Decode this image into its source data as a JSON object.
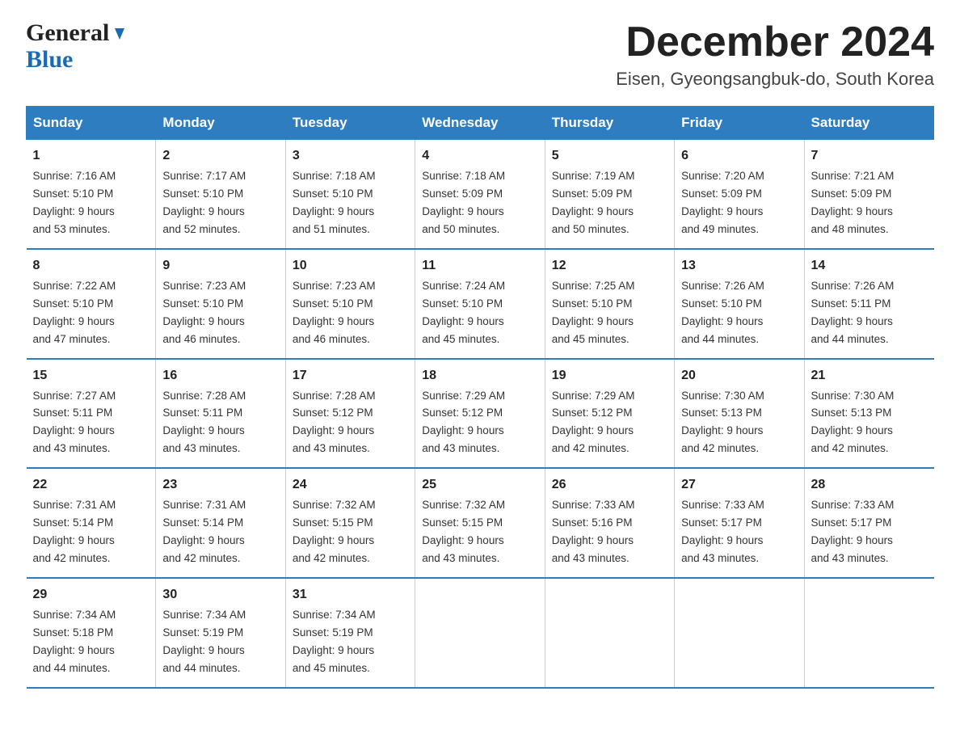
{
  "logo": {
    "general": "General",
    "blue": "Blue",
    "arrow": "▲"
  },
  "title": {
    "month": "December 2024",
    "location": "Eisen, Gyeongsangbuk-do, South Korea"
  },
  "header_days": [
    "Sunday",
    "Monday",
    "Tuesday",
    "Wednesday",
    "Thursday",
    "Friday",
    "Saturday"
  ],
  "weeks": [
    [
      {
        "day": "1",
        "sunrise": "7:16 AM",
        "sunset": "5:10 PM",
        "daylight": "9 hours and 53 minutes."
      },
      {
        "day": "2",
        "sunrise": "7:17 AM",
        "sunset": "5:10 PM",
        "daylight": "9 hours and 52 minutes."
      },
      {
        "day": "3",
        "sunrise": "7:18 AM",
        "sunset": "5:10 PM",
        "daylight": "9 hours and 51 minutes."
      },
      {
        "day": "4",
        "sunrise": "7:18 AM",
        "sunset": "5:09 PM",
        "daylight": "9 hours and 50 minutes."
      },
      {
        "day": "5",
        "sunrise": "7:19 AM",
        "sunset": "5:09 PM",
        "daylight": "9 hours and 50 minutes."
      },
      {
        "day": "6",
        "sunrise": "7:20 AM",
        "sunset": "5:09 PM",
        "daylight": "9 hours and 49 minutes."
      },
      {
        "day": "7",
        "sunrise": "7:21 AM",
        "sunset": "5:09 PM",
        "daylight": "9 hours and 48 minutes."
      }
    ],
    [
      {
        "day": "8",
        "sunrise": "7:22 AM",
        "sunset": "5:10 PM",
        "daylight": "9 hours and 47 minutes."
      },
      {
        "day": "9",
        "sunrise": "7:23 AM",
        "sunset": "5:10 PM",
        "daylight": "9 hours and 46 minutes."
      },
      {
        "day": "10",
        "sunrise": "7:23 AM",
        "sunset": "5:10 PM",
        "daylight": "9 hours and 46 minutes."
      },
      {
        "day": "11",
        "sunrise": "7:24 AM",
        "sunset": "5:10 PM",
        "daylight": "9 hours and 45 minutes."
      },
      {
        "day": "12",
        "sunrise": "7:25 AM",
        "sunset": "5:10 PM",
        "daylight": "9 hours and 45 minutes."
      },
      {
        "day": "13",
        "sunrise": "7:26 AM",
        "sunset": "5:10 PM",
        "daylight": "9 hours and 44 minutes."
      },
      {
        "day": "14",
        "sunrise": "7:26 AM",
        "sunset": "5:11 PM",
        "daylight": "9 hours and 44 minutes."
      }
    ],
    [
      {
        "day": "15",
        "sunrise": "7:27 AM",
        "sunset": "5:11 PM",
        "daylight": "9 hours and 43 minutes."
      },
      {
        "day": "16",
        "sunrise": "7:28 AM",
        "sunset": "5:11 PM",
        "daylight": "9 hours and 43 minutes."
      },
      {
        "day": "17",
        "sunrise": "7:28 AM",
        "sunset": "5:12 PM",
        "daylight": "9 hours and 43 minutes."
      },
      {
        "day": "18",
        "sunrise": "7:29 AM",
        "sunset": "5:12 PM",
        "daylight": "9 hours and 43 minutes."
      },
      {
        "day": "19",
        "sunrise": "7:29 AM",
        "sunset": "5:12 PM",
        "daylight": "9 hours and 42 minutes."
      },
      {
        "day": "20",
        "sunrise": "7:30 AM",
        "sunset": "5:13 PM",
        "daylight": "9 hours and 42 minutes."
      },
      {
        "day": "21",
        "sunrise": "7:30 AM",
        "sunset": "5:13 PM",
        "daylight": "9 hours and 42 minutes."
      }
    ],
    [
      {
        "day": "22",
        "sunrise": "7:31 AM",
        "sunset": "5:14 PM",
        "daylight": "9 hours and 42 minutes."
      },
      {
        "day": "23",
        "sunrise": "7:31 AM",
        "sunset": "5:14 PM",
        "daylight": "9 hours and 42 minutes."
      },
      {
        "day": "24",
        "sunrise": "7:32 AM",
        "sunset": "5:15 PM",
        "daylight": "9 hours and 42 minutes."
      },
      {
        "day": "25",
        "sunrise": "7:32 AM",
        "sunset": "5:15 PM",
        "daylight": "9 hours and 43 minutes."
      },
      {
        "day": "26",
        "sunrise": "7:33 AM",
        "sunset": "5:16 PM",
        "daylight": "9 hours and 43 minutes."
      },
      {
        "day": "27",
        "sunrise": "7:33 AM",
        "sunset": "5:17 PM",
        "daylight": "9 hours and 43 minutes."
      },
      {
        "day": "28",
        "sunrise": "7:33 AM",
        "sunset": "5:17 PM",
        "daylight": "9 hours and 43 minutes."
      }
    ],
    [
      {
        "day": "29",
        "sunrise": "7:34 AM",
        "sunset": "5:18 PM",
        "daylight": "9 hours and 44 minutes."
      },
      {
        "day": "30",
        "sunrise": "7:34 AM",
        "sunset": "5:19 PM",
        "daylight": "9 hours and 44 minutes."
      },
      {
        "day": "31",
        "sunrise": "7:34 AM",
        "sunset": "5:19 PM",
        "daylight": "9 hours and 45 minutes."
      },
      null,
      null,
      null,
      null
    ]
  ],
  "labels": {
    "sunrise": "Sunrise:",
    "sunset": "Sunset:",
    "daylight": "Daylight:"
  }
}
